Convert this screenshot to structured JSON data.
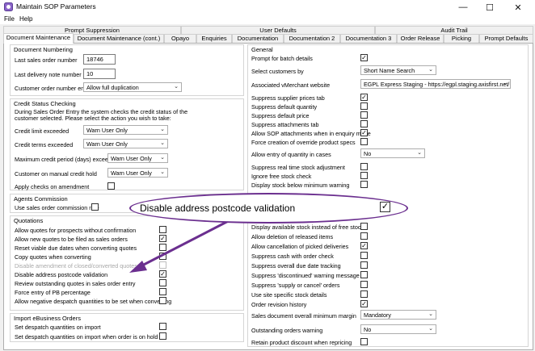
{
  "window": {
    "title": "Maintain SOP Parameters",
    "minimize": "—",
    "maximize": "☐",
    "close": "✕"
  },
  "menu": [
    "File",
    "Help"
  ],
  "tabs_top": [
    "Prompt Suppression",
    "User Defaults",
    "Audit Trail"
  ],
  "tabs_bottom": [
    "Document Maintenance",
    "Document Maintenance (cont.)",
    "Opayo",
    "Enquiries",
    "Documentation",
    "Documentation 2",
    "Documentation 3",
    "Order Release",
    "Picking",
    "Prompt Defaults"
  ],
  "doc_numbering": {
    "title": "Document Numbering",
    "last_sales_order_label": "Last sales order number",
    "last_sales_order_value": "18746",
    "last_delivery_label": "Last delivery note number",
    "last_delivery_value": "10",
    "entry_label": "Customer order number entry",
    "entry_value": "Allow full duplication"
  },
  "credit": {
    "title": "Credit Status Checking",
    "description": "During Sales Order Entry the system checks the credit status of the customer selected. Please select the action you wish to take:",
    "rows": [
      {
        "label": "Credit limit exceeded",
        "value": "Warn User Only"
      },
      {
        "label": "Credit terms exceeded",
        "value": "Warn User Only"
      },
      {
        "label": "Maximum credit period (days) exceeded",
        "value": "Warn User Only"
      },
      {
        "label": "Customer on manual credit hold",
        "value": "Warn User Only"
      }
    ],
    "apply_label": "Apply checks on amendment"
  },
  "agents": {
    "title": "Agents Commission",
    "use_label": "Use sales order commission rate"
  },
  "quotations": {
    "title": "Quotations",
    "items": [
      {
        "label": "Allow quotes for prospects without confirmation",
        "checked": ""
      },
      {
        "label": "Allow new quotes to be filed as sales orders",
        "checked": "✓"
      },
      {
        "label": "Reset viable due dates when converting quotes",
        "checked": ""
      },
      {
        "label": "Copy quotes when converting",
        "checked": ""
      },
      {
        "label": "Disable amendment of closed/converted quotes",
        "checked": ""
      },
      {
        "label": "Disable address postcode validation",
        "checked": "✓"
      },
      {
        "label": "Review outstanding quotes in sales order entry",
        "checked": ""
      },
      {
        "label": "Force entry of PB percentage",
        "checked": ""
      },
      {
        "label": "Allow negative despatch quantities to be set when converting",
        "checked": ""
      }
    ]
  },
  "import": {
    "title": "Import eBusiness Orders",
    "items": [
      {
        "label": "Set despatch quantities on import",
        "checked": ""
      },
      {
        "label": "Set despatch quantities on import when order is on hold",
        "checked": ""
      }
    ]
  },
  "general": {
    "title": "General",
    "prompt_batch": {
      "label": "Prompt for batch details",
      "checked": "✓"
    },
    "select_customers": {
      "label": "Select customers by",
      "value": "Short Name Search"
    },
    "vmerchant": {
      "label": "Associated vMerchant website",
      "value": "EGPL Express Staging - https://egpl.staging.axisfirst.net/"
    },
    "list1": [
      {
        "label": "Suppress supplier prices tab",
        "checked": "✓"
      },
      {
        "label": "Suppress default quantity",
        "checked": ""
      },
      {
        "label": "Suppress default price",
        "checked": ""
      },
      {
        "label": "Suppress attachments tab",
        "checked": ""
      },
      {
        "label": "Allow SOP attachments when in enquiry mode",
        "checked": "✓"
      },
      {
        "label": "Force creation of override product specs",
        "checked": ""
      }
    ],
    "allow_entry": {
      "label": "Allow entry of quantity in cases",
      "value": "No"
    },
    "list2": [
      {
        "label": "Suppress real time stock adjustment",
        "checked": ""
      },
      {
        "label": "Ignore free stock check",
        "checked": ""
      },
      {
        "label": "Display stock below minimum warning",
        "checked": ""
      },
      {
        "label": "Display available stock instead of free stock",
        "checked": ""
      },
      {
        "label": "Allow deletion of released items",
        "checked": ""
      },
      {
        "label": "Allow cancellation of picked deliveries",
        "checked": "✓"
      },
      {
        "label": "Suppress cash with order check",
        "checked": ""
      },
      {
        "label": "Suppress overall due date tracking",
        "checked": ""
      },
      {
        "label": "Suppress 'discontinued' warning message",
        "checked": ""
      },
      {
        "label": "Suppress 'supply or cancel' orders",
        "checked": ""
      },
      {
        "label": "Use site specific stock details",
        "checked": ""
      },
      {
        "label": "Order revision history",
        "checked": "✓"
      }
    ],
    "margin": {
      "label": "Sales document overall minimum margin",
      "value": "Mandatory"
    },
    "outstanding": {
      "label": "Outstanding orders warning",
      "value": "No"
    },
    "retain": {
      "label": "Retain product discount when repricing",
      "checked": ""
    }
  },
  "callout": {
    "text": "Disable address postcode validation",
    "checked": "✓"
  },
  "colors": {
    "accent": "#6b2f8f"
  }
}
